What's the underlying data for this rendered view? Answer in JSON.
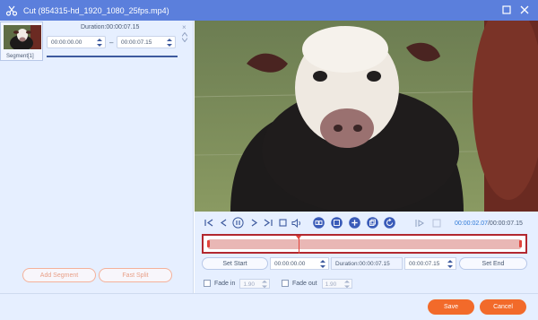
{
  "window": {
    "title": "Cut (854315-hd_1920_1080_25fps.mp4)",
    "icons": [
      "scissors-icon",
      "restore-icon",
      "close-icon"
    ]
  },
  "segment_panel": {
    "segment_label": "Segment[1]",
    "duration_label": "Duration:00:00:07.15",
    "start_time": "00:00:00.00",
    "end_time": "00:00:07.15",
    "dash": "–",
    "close_glyph": "×"
  },
  "left_buttons": {
    "add_segment": "Add Segment",
    "fast_split": "Fast Split"
  },
  "playback": {
    "current_time": "00:00:02.07",
    "total_time": "/00:00:07.15",
    "playhead_fraction": 0.29
  },
  "set_row": {
    "set_start": "Set Start",
    "start_value": "00:00:00.00",
    "duration_value": "Duration:00:00:07.15",
    "end_value": "00:00:07.15",
    "set_end": "Set End"
  },
  "fade": {
    "fade_in_label": "Fade in",
    "fade_in_value": "1.90",
    "fade_out_label": "Fade out",
    "fade_out_value": "1.90"
  },
  "footer": {
    "save": "Save",
    "cancel": "Cancel"
  },
  "colors": {
    "titlebar": "#5b7fdc",
    "accent_orange": "#f26a2a",
    "timeline_border": "#b2282f",
    "timeline_fill": "#e9b7b5",
    "time_blue": "#2f7ad8"
  }
}
